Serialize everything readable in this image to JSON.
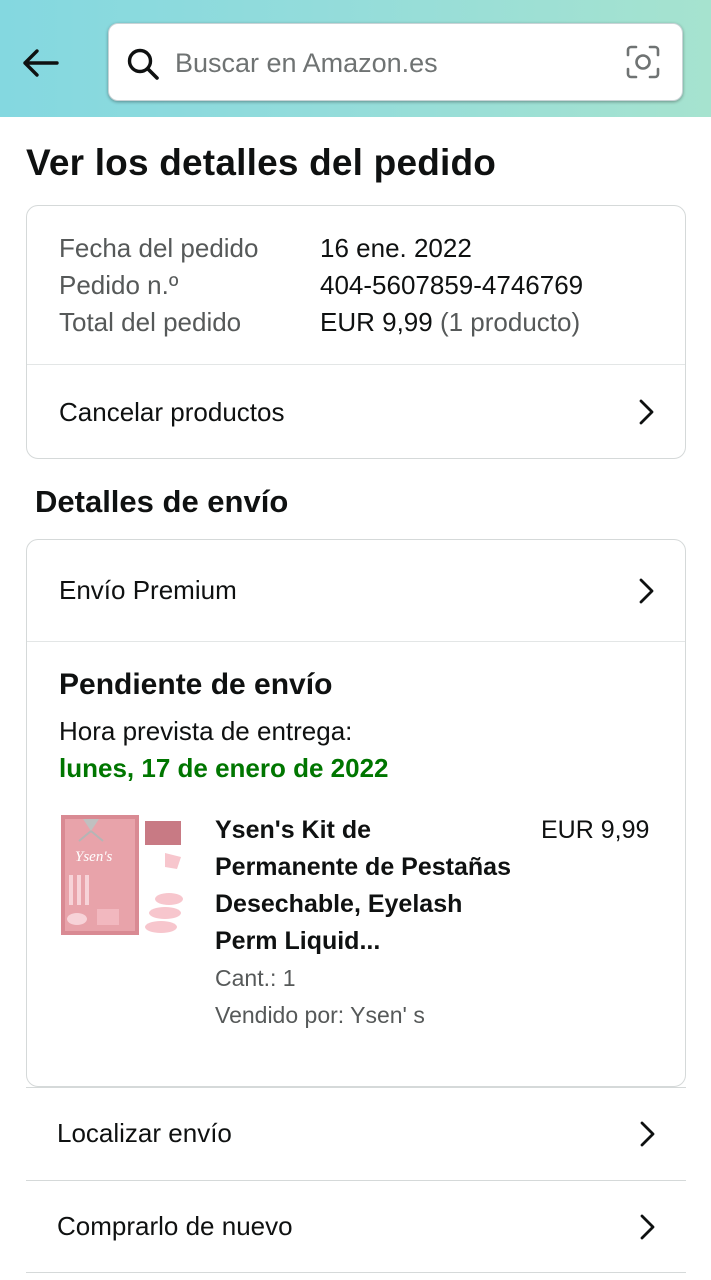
{
  "header": {
    "search_placeholder": "Buscar en Amazon.es",
    "gradient_colors": [
      "#84d8e0",
      "#a6e3cf"
    ]
  },
  "page": {
    "title": "Ver los detalles del pedido"
  },
  "order_summary": {
    "date_label": "Fecha del pedido",
    "date_value": "16 ene. 2022",
    "number_label": "Pedido n.º",
    "number_value": "404-5607859-4746769",
    "total_label": "Total del pedido",
    "total_value": "EUR 9,99",
    "total_count": "(1 producto)",
    "cancel_label": "Cancelar productos"
  },
  "shipping": {
    "section_title": "Detalles de envío",
    "method_label": "Envío Premium",
    "status": "Pendiente de envío",
    "delivery_label": "Hora prevista de entrega:",
    "delivery_date": "lunes, 17 de enero de 2022",
    "delivery_color": "#007600"
  },
  "product": {
    "title": "Ysen's Kit de Permanente de Pestañas Desechable, Eyelash Perm Liquid...",
    "price": "EUR 9,99",
    "quantity": "Cant.: 1",
    "seller": "Vendido por: Ysen' s",
    "thumb_brand": "Ysen's"
  },
  "actions": {
    "track": "Localizar envío",
    "buy_again": "Comprarlo de nuevo"
  }
}
